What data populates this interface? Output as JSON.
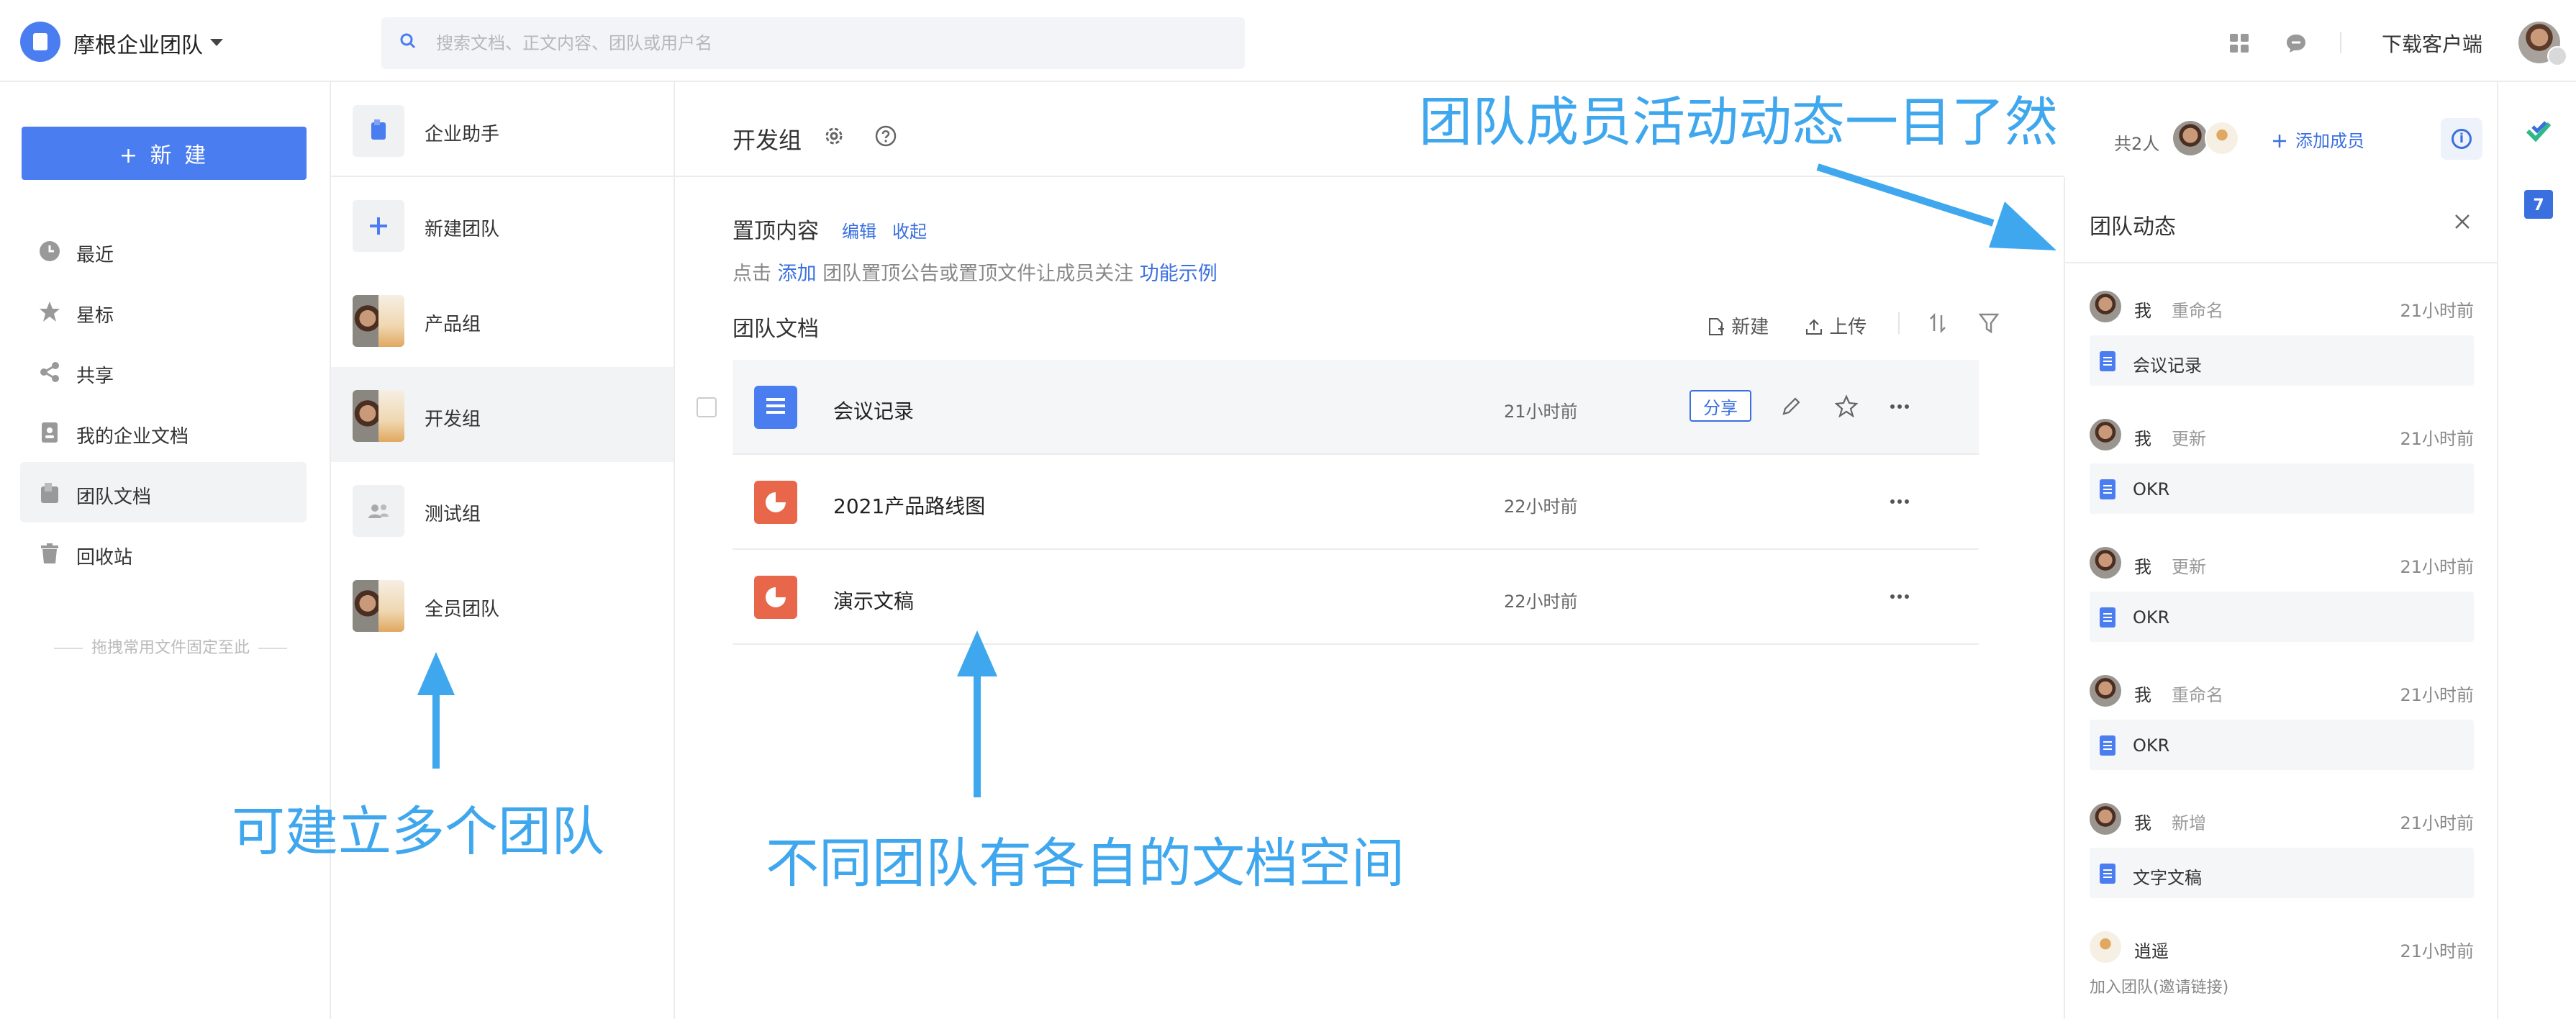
{
  "topbar": {
    "team_name": "摩根企业团队",
    "search_placeholder": "搜索文档、正文内容、团队或用户名",
    "download_label": "下载客户端"
  },
  "leftnav": {
    "new_button": "+ 新 建",
    "items": [
      {
        "label": "最近",
        "icon": "clock-icon"
      },
      {
        "label": "星标",
        "icon": "star-icon"
      },
      {
        "label": "共享",
        "icon": "share-icon"
      },
      {
        "label": "我的企业文档",
        "icon": "enterprise-doc-icon"
      },
      {
        "label": "团队文档",
        "icon": "team-doc-icon",
        "active": true
      },
      {
        "label": "回收站",
        "icon": "trash-icon"
      }
    ],
    "pin_hint": "拖拽常用文件固定至此"
  },
  "teams": {
    "items": [
      {
        "label": "企业助手"
      },
      {
        "label": "新建团队"
      },
      {
        "label": "产品组"
      },
      {
        "label": "开发组",
        "active": true
      },
      {
        "label": "测试组"
      },
      {
        "label": "全员团队"
      }
    ]
  },
  "main": {
    "group_title": "开发组",
    "pinned": {
      "title": "置顶内容",
      "edit": "编辑",
      "collapse": "收起",
      "hint_prefix": "点击",
      "hint_add": "添加",
      "hint_middle": "团队置顶公告或置顶文件让成员关注",
      "hint_example": "功能示例"
    },
    "docs_title": "团队文档",
    "toolbar": {
      "new": "新建",
      "upload": "上传"
    },
    "docs": [
      {
        "name": "会议记录",
        "time": "21小时前",
        "type": "doc",
        "share": "分享"
      },
      {
        "name": "2021产品路线图",
        "time": "22小时前",
        "type": "slide"
      },
      {
        "name": "演示文稿",
        "time": "22小时前",
        "type": "slide"
      }
    ]
  },
  "members": {
    "count": "共2人",
    "add": "添加成员"
  },
  "activity": {
    "title": "团队动态",
    "items": [
      {
        "user": "我",
        "action": "重命名",
        "time": "21小时前",
        "file": "会议记录"
      },
      {
        "user": "我",
        "action": "更新",
        "time": "21小时前",
        "file": "OKR"
      },
      {
        "user": "我",
        "action": "更新",
        "time": "21小时前",
        "file": "OKR"
      },
      {
        "user": "我",
        "action": "重命名",
        "time": "21小时前",
        "file": "OKR"
      },
      {
        "user": "我",
        "action": "新增",
        "time": "21小时前",
        "file": "文字文稿"
      },
      {
        "user": "逍遥",
        "action": "",
        "time": "21小时前",
        "note": "加入团队(邀请链接)"
      }
    ]
  },
  "rail": {
    "calendar_day": "7"
  },
  "annotations": {
    "multi_team": "可建立多个团队",
    "separate_space": "不同团队有各自的文档空间",
    "activity_overview": "团队成员活动动态一目了然"
  },
  "colors": {
    "accent": "#4a7df0",
    "link": "#3a6fe0",
    "slide": "#e8664a",
    "annotation": "#3fa7ee"
  }
}
